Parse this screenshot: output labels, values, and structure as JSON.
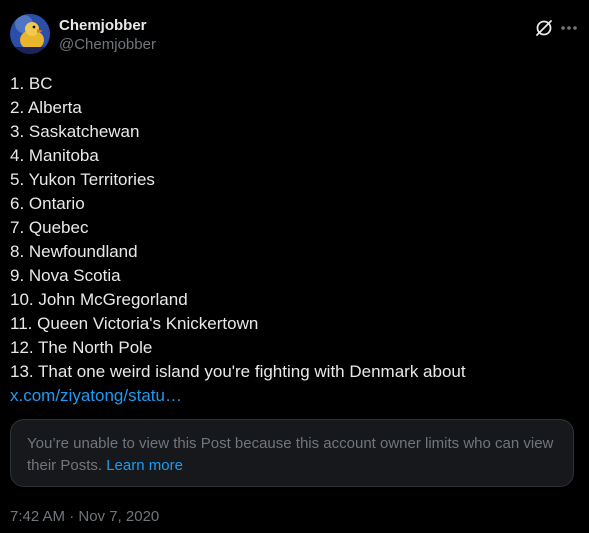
{
  "author": {
    "display_name": "Chemjobber",
    "handle": "@Chemjobber",
    "avatar_icon": "avatar-duck-icon"
  },
  "icons": {
    "grok": "grok-icon",
    "more": "more-icon"
  },
  "tweet": {
    "lines": [
      "1. BC",
      "2. Alberta",
      "3. Saskatchewan",
      "4. Manitoba",
      "5. Yukon Territories",
      "6. Ontario",
      "7. Quebec",
      "8. Newfoundland",
      "9. Nova Scotia",
      "10. John McGregorland",
      "11. Queen Victoria's Knickertown",
      "12. The North Pole",
      "13. That one weird island you're fighting with Denmark about"
    ],
    "link": "x.com/ziyatong/statu…"
  },
  "notice": {
    "text": "You’re unable to view this Post because this account owner limits who can view their Posts.",
    "learn_more": "Learn more"
  },
  "timestamp": "7:42 AM · Nov 7, 2020",
  "colors": {
    "background": "#000000",
    "text": "#e7e9ea",
    "secondary": "#71767b",
    "link": "#1d9bf0",
    "notice_bg": "#16181c",
    "border": "#2f3336"
  }
}
